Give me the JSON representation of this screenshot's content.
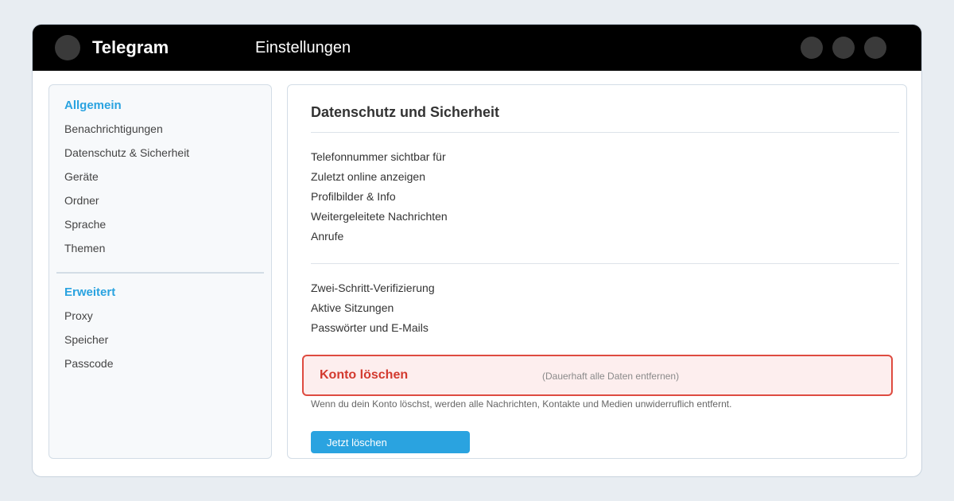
{
  "header": {
    "app_title": "Telegram",
    "page_title": "Einstellungen"
  },
  "sidebar": {
    "groups": [
      {
        "title": "Allgemein",
        "items": [
          "Benachrichtigungen",
          "Datenschutz & Sicherheit",
          "Geräte",
          "Ordner",
          "Sprache",
          "Themen"
        ]
      },
      {
        "title": "Erweitert",
        "items": [
          "Proxy",
          "Speicher",
          "Passcode"
        ]
      }
    ]
  },
  "main": {
    "title": "Datenschutz und Sicherheit",
    "privacy_items": [
      "Telefonnummer sichtbar für",
      "Zuletzt online anzeigen",
      "Profilbilder & Info",
      "Weitergeleitete Nachrichten",
      "Anrufe"
    ],
    "security_items": [
      "Zwei-Schritt-Verifizierung",
      "Aktive Sitzungen",
      "Passwörter und E-Mails"
    ],
    "delete_account": {
      "label": "Konto löschen",
      "hint": "(Dauerhaft alle Daten entfernen)",
      "warning": "Wenn du dein Konto löschst, werden alle Nachrichten, Kontakte und Medien unwiderruflich entfernt.",
      "button_label": "Jetzt löschen"
    }
  },
  "colors": {
    "accent": "#2aa3e0",
    "danger": "#d33a2f",
    "danger_bg": "#fdeeee",
    "topbar": "#000000"
  }
}
